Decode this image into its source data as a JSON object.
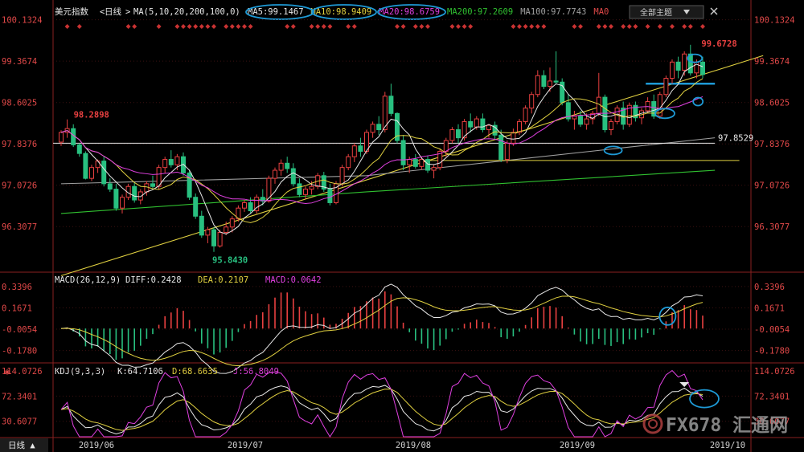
{
  "chart_data": {
    "type": "candlestick",
    "symbol": "美元指数",
    "period": "日线",
    "header": {
      "ma_label": "MA(5,10,20,200,100,0)",
      "ma_values": [
        {
          "text": "MA5:99.1467",
          "color": "#e8e8e8"
        },
        {
          "text": "MA10:98.9409",
          "color": "#e0d040"
        },
        {
          "text": "MA20:98.6759",
          "color": "#e040e0"
        },
        {
          "text": "MA200:97.2609",
          "color": "#30c030"
        },
        {
          "text": "MA100:97.7743",
          "color": "#a0a0a0"
        },
        {
          "text": "MA0",
          "color": "#e04848"
        }
      ],
      "right_button": "全部主题"
    },
    "main_axis": {
      "ylim": [
        95.45,
        100.35
      ],
      "ticks": [
        "100.1324",
        "99.3674",
        "98.6025",
        "97.8376",
        "97.0726",
        "96.3077"
      ]
    },
    "annotations": {
      "high": "99.6728",
      "low": "95.8430",
      "left_peak": "98.2898",
      "level": "97.8529"
    },
    "x_labels": [
      "2019/06",
      "2019/07",
      "2019/08",
      "2019/09",
      "2019/10"
    ],
    "candles": [
      [
        97.87,
        98.09,
        97.8,
        98.05
      ],
      [
        98.05,
        98.29,
        97.95,
        98.12
      ],
      [
        98.12,
        98.2,
        97.78,
        97.82
      ],
      [
        97.82,
        97.85,
        97.6,
        97.66
      ],
      [
        97.66,
        97.7,
        97.18,
        97.2
      ],
      [
        97.2,
        97.45,
        97.15,
        97.4
      ],
      [
        97.4,
        97.55,
        97.3,
        97.52
      ],
      [
        97.52,
        97.6,
        97.05,
        97.1
      ],
      [
        97.1,
        97.2,
        96.95,
        97.0
      ],
      [
        97.0,
        97.1,
        96.6,
        96.65
      ],
      [
        96.65,
        96.9,
        96.55,
        96.85
      ],
      [
        96.85,
        97.1,
        96.8,
        97.05
      ],
      [
        97.05,
        97.12,
        96.75,
        96.8
      ],
      [
        96.8,
        97.0,
        96.72,
        96.95
      ],
      [
        96.95,
        97.15,
        96.88,
        97.1
      ],
      [
        97.1,
        97.25,
        97.0,
        97.05
      ],
      [
        97.05,
        97.45,
        97.0,
        97.4
      ],
      [
        97.4,
        97.6,
        97.3,
        97.55
      ],
      [
        97.55,
        97.72,
        97.4,
        97.45
      ],
      [
        97.45,
        97.65,
        97.35,
        97.6
      ],
      [
        97.6,
        97.68,
        97.25,
        97.3
      ],
      [
        97.3,
        97.35,
        96.8,
        96.85
      ],
      [
        96.85,
        96.92,
        96.45,
        96.5
      ],
      [
        96.5,
        96.6,
        96.1,
        96.15
      ],
      [
        96.15,
        96.3,
        96.0,
        96.25
      ],
      [
        96.25,
        96.3,
        95.84,
        95.95
      ],
      [
        95.95,
        96.25,
        95.92,
        96.2
      ],
      [
        96.2,
        96.4,
        96.15,
        96.3
      ],
      [
        96.3,
        96.5,
        96.2,
        96.45
      ],
      [
        96.45,
        96.7,
        96.4,
        96.65
      ],
      [
        96.65,
        96.8,
        96.58,
        96.75
      ],
      [
        96.75,
        96.85,
        96.55,
        96.6
      ],
      [
        96.6,
        96.9,
        96.55,
        96.85
      ],
      [
        96.85,
        97.0,
        96.7,
        96.78
      ],
      [
        96.78,
        97.25,
        96.75,
        97.2
      ],
      [
        97.2,
        97.4,
        97.1,
        97.35
      ],
      [
        97.35,
        97.55,
        97.25,
        97.48
      ],
      [
        97.48,
        97.6,
        97.3,
        97.38
      ],
      [
        97.38,
        97.48,
        97.05,
        97.1
      ],
      [
        97.1,
        97.2,
        96.85,
        96.9
      ],
      [
        96.9,
        97.05,
        96.82,
        97.0
      ],
      [
        97.0,
        97.15,
        96.9,
        97.05
      ],
      [
        97.05,
        97.3,
        97.0,
        97.25
      ],
      [
        97.25,
        97.32,
        96.95,
        97.0
      ],
      [
        97.0,
        97.1,
        96.7,
        96.75
      ],
      [
        96.75,
        97.15,
        96.72,
        97.1
      ],
      [
        97.1,
        97.45,
        97.05,
        97.4
      ],
      [
        97.4,
        97.65,
        97.35,
        97.6
      ],
      [
        97.6,
        97.85,
        97.5,
        97.8
      ],
      [
        97.8,
        97.95,
        97.6,
        97.7
      ],
      [
        97.7,
        98.1,
        97.65,
        98.05
      ],
      [
        98.05,
        98.25,
        97.95,
        98.2
      ],
      [
        98.2,
        98.35,
        98.0,
        98.1
      ],
      [
        98.1,
        98.8,
        98.05,
        98.72
      ],
      [
        98.72,
        98.95,
        98.35,
        98.4
      ],
      [
        98.4,
        98.42,
        97.85,
        97.9
      ],
      [
        97.9,
        98.0,
        97.35,
        97.45
      ],
      [
        97.45,
        97.6,
        97.3,
        97.55
      ],
      [
        97.55,
        97.65,
        97.38,
        97.42
      ],
      [
        97.42,
        97.6,
        97.36,
        97.55
      ],
      [
        97.55,
        97.62,
        97.3,
        97.35
      ],
      [
        97.35,
        97.45,
        97.2,
        97.4
      ],
      [
        97.4,
        97.75,
        97.35,
        97.7
      ],
      [
        97.7,
        97.95,
        97.6,
        97.9
      ],
      [
        97.9,
        98.15,
        97.85,
        98.1
      ],
      [
        98.1,
        98.2,
        97.85,
        97.95
      ],
      [
        97.95,
        98.3,
        97.9,
        98.25
      ],
      [
        98.25,
        98.4,
        98.05,
        98.15
      ],
      [
        98.15,
        98.35,
        98.1,
        98.3
      ],
      [
        98.3,
        98.4,
        98.05,
        98.1
      ],
      [
        98.1,
        98.2,
        97.95,
        98.18
      ],
      [
        98.18,
        98.25,
        97.92,
        98.0
      ],
      [
        98.0,
        98.1,
        97.5,
        97.55
      ],
      [
        97.55,
        97.9,
        97.48,
        97.85
      ],
      [
        97.85,
        98.12,
        97.8,
        98.05
      ],
      [
        98.05,
        98.3,
        98.0,
        98.25
      ],
      [
        98.25,
        98.55,
        98.2,
        98.5
      ],
      [
        98.5,
        98.8,
        98.4,
        98.75
      ],
      [
        98.75,
        99.2,
        98.7,
        99.1
      ],
      [
        99.1,
        99.2,
        98.85,
        98.9
      ],
      [
        98.9,
        99.25,
        98.8,
        99.0
      ],
      [
        99.0,
        99.55,
        98.95,
        98.98
      ],
      [
        98.98,
        99.05,
        98.55,
        98.6
      ],
      [
        98.6,
        98.75,
        98.25,
        98.3
      ],
      [
        98.3,
        98.45,
        98.1,
        98.35
      ],
      [
        98.35,
        98.45,
        98.15,
        98.2
      ],
      [
        98.2,
        98.4,
        98.1,
        98.3
      ],
      [
        98.3,
        98.45,
        98.2,
        98.4
      ],
      [
        98.4,
        99.15,
        98.35,
        98.7
      ],
      [
        98.7,
        98.75,
        98.05,
        98.1
      ],
      [
        98.1,
        98.3,
        98.0,
        98.25
      ],
      [
        98.25,
        98.55,
        98.2,
        98.5
      ],
      [
        98.5,
        98.62,
        98.1,
        98.2
      ],
      [
        98.2,
        98.6,
        98.15,
        98.55
      ],
      [
        98.55,
        98.62,
        98.25,
        98.32
      ],
      [
        98.32,
        98.5,
        98.2,
        98.45
      ],
      [
        98.45,
        98.7,
        98.4,
        98.62
      ],
      [
        98.62,
        98.75,
        98.3,
        98.35
      ],
      [
        98.35,
        98.8,
        98.3,
        98.75
      ],
      [
        98.75,
        99.1,
        98.7,
        99.05
      ],
      [
        99.05,
        99.4,
        98.95,
        99.35
      ],
      [
        99.35,
        99.45,
        99.05,
        99.2
      ],
      [
        99.2,
        99.55,
        99.1,
        99.5
      ],
      [
        99.5,
        99.67,
        99.1,
        99.15
      ],
      [
        99.15,
        99.4,
        99.05,
        99.35
      ],
      [
        99.35,
        99.45,
        99.05,
        99.12
      ]
    ],
    "ma_overlays": {
      "ma200": [
        [
          0,
          96.55
        ],
        [
          50,
          96.95
        ],
        [
          107,
          97.35
        ]
      ],
      "ma100": [
        [
          0,
          97.1
        ],
        [
          50,
          97.25
        ],
        [
          107,
          97.95
        ]
      ]
    },
    "trendline": [
      [
        0,
        95.4
      ],
      [
        107,
        98.92
      ]
    ],
    "level_lines": [
      {
        "value": 97.85,
        "x_range": [
          0,
          107
        ]
      },
      {
        "value": 97.53,
        "x_range": [
          58,
          111
        ]
      },
      {
        "value": 98.95,
        "x_range": [
          97,
          107
        ]
      }
    ],
    "macd": {
      "label": "MACD(26,12,9)",
      "values": [
        "DIFF:0.2428",
        "DEA:0.2107",
        "MACD:0.0642"
      ],
      "ticks": [
        "0.3396",
        "0.1671",
        "-0.0054",
        "-0.1780"
      ],
      "ylim": [
        -0.265,
        0.43
      ]
    },
    "kdj": {
      "label": "KDJ(9,3,3)",
      "values": [
        "K:64.7106",
        "D:68.6635",
        "J:56.8049"
      ],
      "ticks": [
        "114.0726",
        "72.3401",
        "30.6077"
      ],
      "ylim": [
        5,
        122
      ]
    },
    "footer_tab": "日线 ▲",
    "watermark": "FX678 汇通网"
  }
}
